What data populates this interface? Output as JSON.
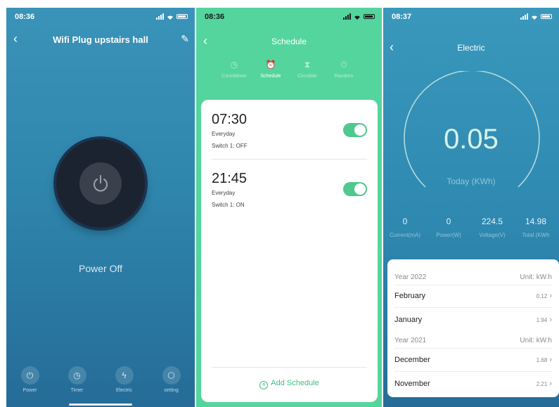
{
  "screen1": {
    "status_time": "08:36",
    "title": "Wifi Plug upstairs hall",
    "power_state": "Power Off",
    "nav": [
      {
        "label": "Power",
        "icon": "power-icon"
      },
      {
        "label": "Timer",
        "icon": "timer-icon"
      },
      {
        "label": "Electric",
        "icon": "bolt-icon"
      },
      {
        "label": "setting",
        "icon": "cube-icon"
      }
    ]
  },
  "screen2": {
    "status_time": "08:36",
    "title": "Schedule",
    "tabs": [
      {
        "label": "Countdown",
        "icon": "clock-icon"
      },
      {
        "label": "Schedule",
        "icon": "alarm-icon"
      },
      {
        "label": "Circulate",
        "icon": "hourglass-icon"
      },
      {
        "label": "Random",
        "icon": "stopwatch-icon"
      }
    ],
    "schedules": [
      {
        "time": "07:30",
        "repeat": "Everyday",
        "action": "Switch 1: OFF",
        "enabled": true
      },
      {
        "time": "21:45",
        "repeat": "Everyday",
        "action": "Switch 1: ON",
        "enabled": true
      }
    ],
    "add_label": "Add Schedule",
    "colors": {
      "accent": "#54d59d"
    }
  },
  "screen3": {
    "status_time": "08:37",
    "title": "Electric",
    "today_value": "0.05",
    "today_label": "Today (KWh)",
    "stats": [
      {
        "value": "0",
        "label": "Current(mA)"
      },
      {
        "value": "0",
        "label": "Power(W)"
      },
      {
        "value": "224.5",
        "label": "Voltage(V)"
      },
      {
        "value": "14.98",
        "label": "Total (KWh"
      }
    ],
    "years": [
      {
        "year": "Year 2022",
        "unit": "Unit: kW.h",
        "months": [
          {
            "name": "February",
            "value": "0.12"
          },
          {
            "name": "January",
            "value": "1.94"
          }
        ]
      },
      {
        "year": "Year 2021",
        "unit": "Unit: kW.h",
        "months": [
          {
            "name": "December",
            "value": "1.68"
          },
          {
            "name": "November",
            "value": "2.21"
          }
        ]
      }
    ]
  }
}
